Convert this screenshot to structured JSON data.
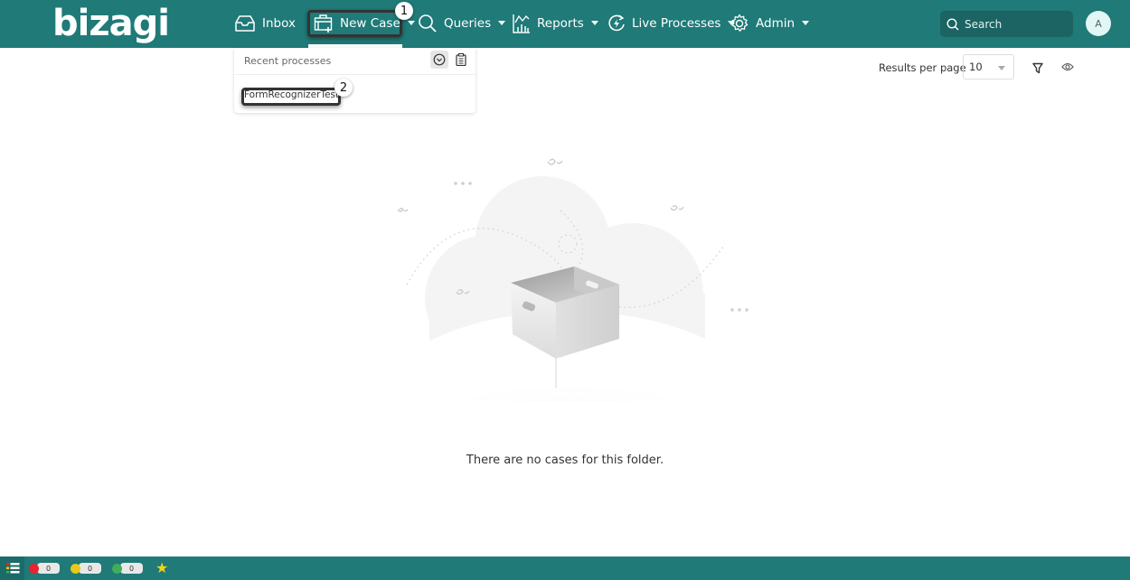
{
  "header": {
    "logo": "bizagi",
    "nav": [
      {
        "label": "Inbox",
        "icon": "inbox-icon",
        "has_caret": false
      },
      {
        "label": "New Case",
        "icon": "new-case-icon",
        "has_caret": true,
        "active": true
      },
      {
        "label": "Queries",
        "icon": "search-icon",
        "has_caret": true
      },
      {
        "label": "Reports",
        "icon": "reports-icon",
        "has_caret": true
      },
      {
        "label": "Live Processes",
        "icon": "live-processes-icon",
        "has_caret": true
      },
      {
        "label": "Admin",
        "icon": "gear-icon",
        "has_caret": true
      }
    ],
    "search": {
      "placeholder": "Search",
      "value": ""
    },
    "avatar_initial": "A"
  },
  "annotations": {
    "step1": "1",
    "step2": "2"
  },
  "new_case_dropdown": {
    "title": "Recent processes",
    "items": [
      "FormRecognizerTest"
    ]
  },
  "toolbar": {
    "results_per_page_label": "Results per page",
    "results_per_page_value": "10"
  },
  "empty_state": {
    "message": "There are no cases for this folder."
  },
  "bottom_bar": {
    "counters": [
      {
        "color": "#e8232e",
        "value": "0"
      },
      {
        "color": "#e8c81a",
        "value": "0"
      },
      {
        "color": "#3fae5a",
        "value": "0"
      }
    ],
    "colors": {
      "brand": "#1f7a78",
      "star": "#f5d318"
    }
  }
}
